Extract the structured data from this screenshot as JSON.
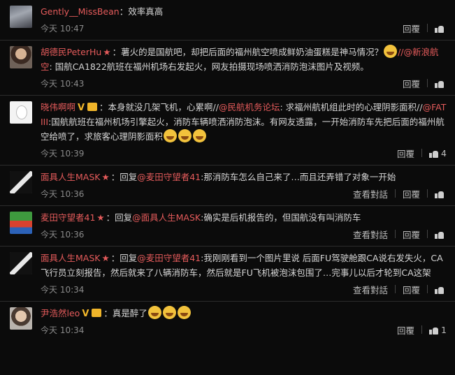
{
  "comments": [
    {
      "user": "Gently__MissBean",
      "after_user": "：效率真高",
      "time": "今天 10:47",
      "reply_label": "回覆",
      "like_count": ""
    },
    {
      "user": "胡德民PeterHu",
      "text_a": "：薯火的是国航吧，却把后面的福州航空喷成鲜奶油蛋糕是神马情况？",
      "mention": "@新浪航空",
      "text_b": ": 国航CA1822航班在福州机场右发起火，网友拍摄现场喷洒消防泡沫图片及视频。",
      "time": "今天 10:43",
      "reply_label": "回覆",
      "like_count": ""
    },
    {
      "user": "晓伟啊啊",
      "text_a": "：本身就没几架飞机，心累啊//",
      "mention1": "@民航机务论坛",
      "text_b": ": 求福州航机组此时的心理阴影面积//",
      "mention2": "@FATIII",
      "text_c": ":国航航班在福州机场引擎起火，消防车辆喷洒消防泡沫。有网友透露，一开始消防车先把后面的福州航空给喷了，求旅客心理阴影面积",
      "time": "今天 10:39",
      "reply_label": "回覆",
      "like_count": "4"
    },
    {
      "user": "面具人生MASK",
      "text_a": "：回复",
      "mention": "@麦田守望者41",
      "text_b": ":那消防车怎么自己来了…而且还弄错了对象一开始",
      "time": "今天 10:36",
      "dialog_label": "查看對話",
      "reply_label": "回覆",
      "like_count": ""
    },
    {
      "user": "麦田守望者41",
      "text_a": "：回复",
      "mention": "@面具人生MASK",
      "text_b": ":确实是后机报告的，但国航没有叫消防车",
      "time": "今天 10:36",
      "dialog_label": "查看對話",
      "reply_label": "回覆",
      "like_count": ""
    },
    {
      "user": "面具人生MASK",
      "text_a": "：回复",
      "mention": "@麦田守望者41",
      "text_b": ":我刚刚看到一个图片里说 后面FU驾驶舱跟CA说右发失火，CA飞行员立刻报告，然后就来了八辆消防车，然后就是FU飞机被泡沫包围了…完事儿以后才轮到CA这架",
      "time": "今天 10:34",
      "dialog_label": "查看對話",
      "reply_label": "回覆",
      "like_count": ""
    },
    {
      "user": "尹浩然leo",
      "after_user": "：真是醉了",
      "time": "今天 10:34",
      "reply_label": "回覆",
      "like_count": "1"
    }
  ]
}
